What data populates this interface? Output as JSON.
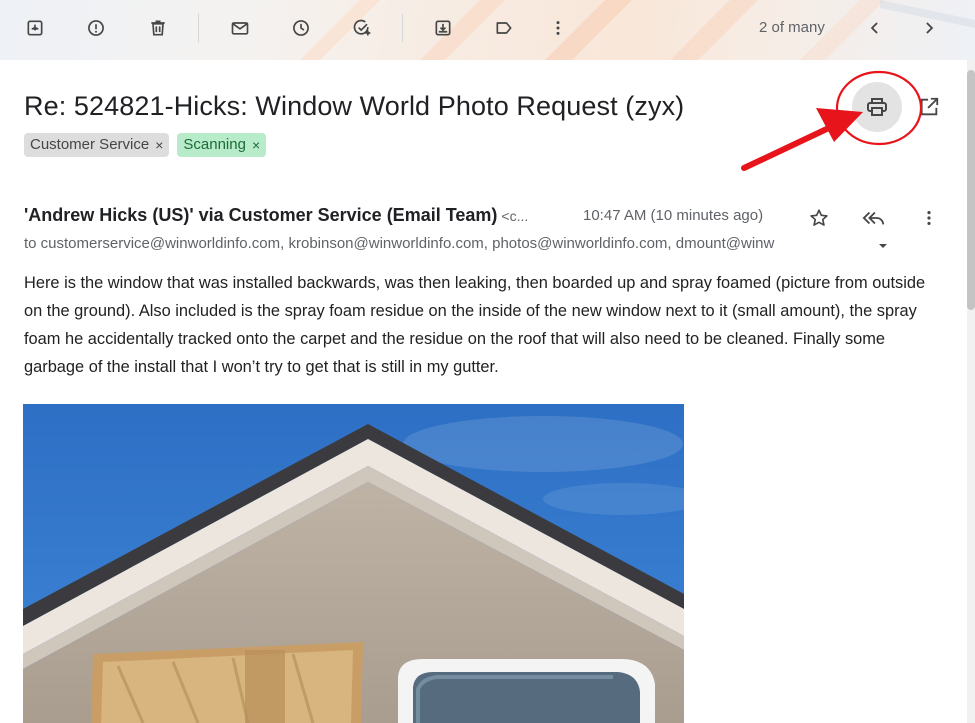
{
  "toolbar": {
    "icons": [
      "archive-icon",
      "report-spam-icon",
      "delete-icon",
      "mark-unread-icon",
      "snooze-icon",
      "add-to-tasks-icon",
      "move-to-icon",
      "label-icon",
      "more-icon"
    ],
    "pager_text": "2 of many",
    "prev_icon": "chevron-left-icon",
    "next_icon": "chevron-right-icon"
  },
  "thread": {
    "subject": "Re: 524821-Hicks: Window World Photo Request (zyx)",
    "labels": [
      {
        "text": "Customer Service",
        "remove": "×",
        "color": "#dddddd"
      },
      {
        "text": "Scanning",
        "remove": "×",
        "color": "#b7ebc9"
      }
    ],
    "print_icon": "print-icon",
    "popout_icon": "open-in-new-window-icon"
  },
  "annotation": {
    "color": "#e8141b"
  },
  "message": {
    "sender_name": "'Andrew Hicks (US)' via Customer Service (Email Team)",
    "sender_email": "<c...",
    "time": "10:47 AM (10 minutes ago)",
    "to": "to customerservice@winworldinfo.com, krobinson@winworldinfo.com, photos@winworldinfo.com, dmount@winw",
    "body": "Here is the window that was installed backwards, was then leaking, then boarded up and spray foamed (picture from outside on the ground). Also included is the spray foam residue on the inside of the new window next to it (small amount), the spray foam he accidentally tracked onto the carpet and the residue on the roof that will also need to be cleaned. Finally some garbage of the install that I won’t try to get that is still in my gutter.",
    "actions": [
      "star-icon",
      "reply-all-icon",
      "more-vert-icon"
    ]
  }
}
